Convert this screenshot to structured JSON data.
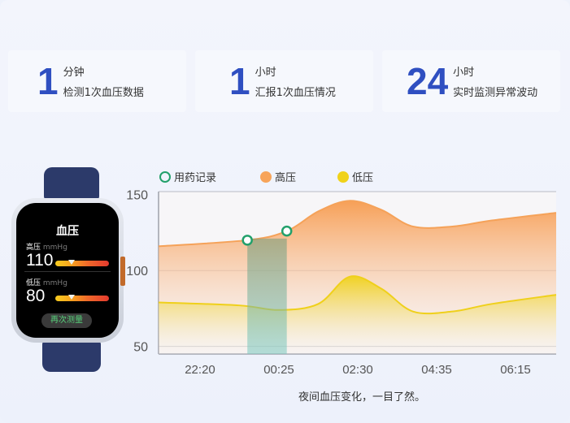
{
  "stats": [
    {
      "number": "1",
      "unit": "分钟",
      "desc": "检测1次血压数据"
    },
    {
      "number": "1",
      "unit": "小时",
      "desc": "汇报1次血压情况"
    },
    {
      "number": "24",
      "unit": "小时",
      "desc": "实时监测异常波动"
    }
  ],
  "watch": {
    "title": "血压",
    "high_label": "高压",
    "low_label": "低压",
    "unit": "mmHg",
    "high_value": "110",
    "low_value": "80",
    "button_label": "再次测量"
  },
  "legend": {
    "medication": "用药记录",
    "high": "高压",
    "low": "低压"
  },
  "caption": "夜间血压变化，一目了然。",
  "colors": {
    "accent": "#2f4fc1",
    "high": "#f7a45a",
    "low": "#f0d21a",
    "medication": "#22a06b"
  },
  "chart_data": {
    "type": "area",
    "x": [
      "22:20",
      "00:25",
      "02:30",
      "04:35",
      "06:15"
    ],
    "ytick_labels": [
      "150",
      "100",
      "50"
    ],
    "ylim": [
      45,
      152
    ],
    "grid": true,
    "legend_position": "top",
    "series": [
      {
        "name": "高压",
        "points": [
          [
            0,
            116
          ],
          [
            0.6,
            120
          ],
          [
            1.1,
            126
          ],
          [
            1.5,
            139
          ],
          [
            1.9,
            146
          ],
          [
            2.3,
            140
          ],
          [
            2.7,
            129
          ],
          [
            3.2,
            129
          ],
          [
            3.7,
            133
          ],
          [
            4.3,
            138
          ]
        ]
      },
      {
        "name": "低压",
        "points": [
          [
            0,
            79
          ],
          [
            0.5,
            77
          ],
          [
            1.0,
            74
          ],
          [
            1.5,
            78
          ],
          [
            1.9,
            96
          ],
          [
            2.3,
            88
          ],
          [
            2.7,
            73
          ],
          [
            3.2,
            73
          ],
          [
            3.7,
            78
          ],
          [
            4.3,
            84
          ]
        ]
      }
    ],
    "medication_markers": [
      [
        0.6,
        120
      ],
      [
        1.1,
        126
      ]
    ],
    "medication_band": [
      0.6,
      1.1
    ]
  }
}
